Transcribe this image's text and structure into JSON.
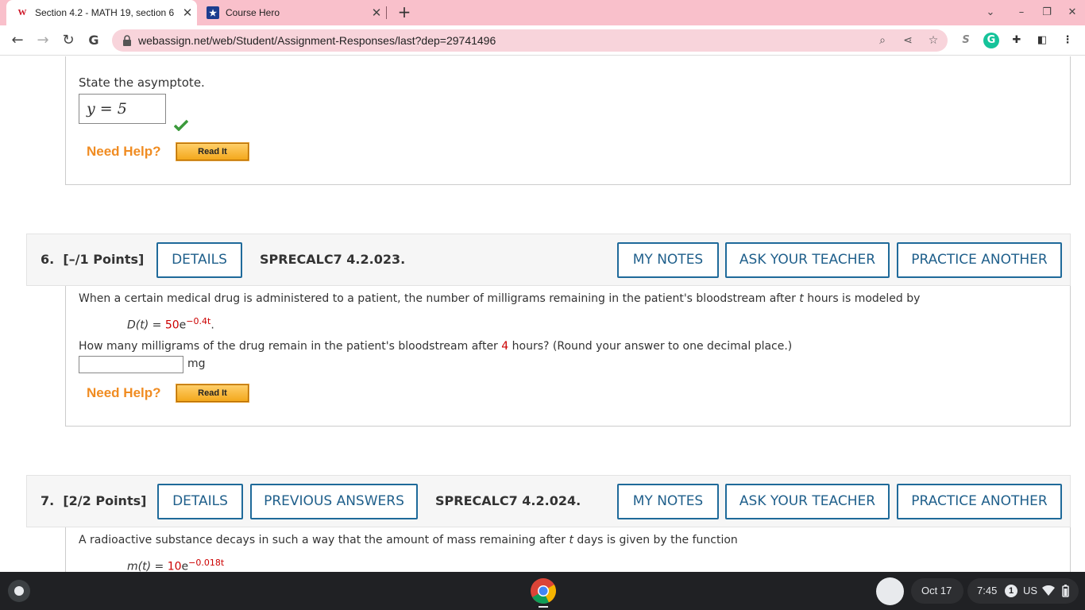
{
  "browser": {
    "tabs": [
      {
        "title": "Section 4.2 - MATH 19, section 6",
        "favicon": "webassign-icon",
        "active": true
      },
      {
        "title": "Course Hero",
        "favicon": "coursehero-icon",
        "active": false
      }
    ],
    "new_tab": "+",
    "url": "webassign.net/web/Student/Assignment-Responses/last?dep=29741496"
  },
  "prev_question": {
    "asymptote_label": "State the asymptote.",
    "answer_value": "y = 5",
    "need_help": "Need Help?",
    "read_it": "Read It"
  },
  "q6": {
    "number": "6.",
    "points": "[–/1 Points]",
    "details": "DETAILS",
    "code": "SPRECALC7 4.2.023.",
    "my_notes": "MY NOTES",
    "ask_teacher": "ASK YOUR TEACHER",
    "practice": "PRACTICE ANOTHER",
    "text_before_t": "When a certain medical drug is administered to a patient, the number of milligrams remaining in the patient's bloodstream after",
    "var_t": "t",
    "text_after_t": "hours is modeled by",
    "formula_lhs": "D(t) =",
    "formula_coef": "50",
    "formula_e": "e",
    "formula_exp": "−0.4t",
    "formula_end": ".",
    "question_before": "How many milligrams of the drug remain in the patient's bloodstream after",
    "question_hours": "4",
    "question_after": "hours? (Round your answer to one decimal place.)",
    "answer_value": "",
    "unit": "mg",
    "need_help": "Need Help?",
    "read_it": "Read It"
  },
  "q7": {
    "number": "7.",
    "points": "[2/2 Points]",
    "details": "DETAILS",
    "previous_answers": "PREVIOUS ANSWERS",
    "code": "SPRECALC7 4.2.024.",
    "my_notes": "MY NOTES",
    "ask_teacher": "ASK YOUR TEACHER",
    "practice": "PRACTICE ANOTHER",
    "text_before_t": "A radioactive substance decays in such a way that the amount of mass remaining after",
    "var_t": "t",
    "text_after_t": "days is given by the function",
    "formula_lhs": "m(t) =",
    "formula_coef": "10",
    "formula_e": "e",
    "formula_exp": "−0.018t"
  },
  "shelf": {
    "date": "Oct 17",
    "time": "7:45",
    "notification_count": "1",
    "locale": "US"
  },
  "colors": {
    "tab_strip": "#f9c0cb",
    "omnibox": "#f8d4db",
    "button_border": "#1f6a9a",
    "need_help": "#f08c22",
    "emphasis_red": "#cc0000"
  }
}
